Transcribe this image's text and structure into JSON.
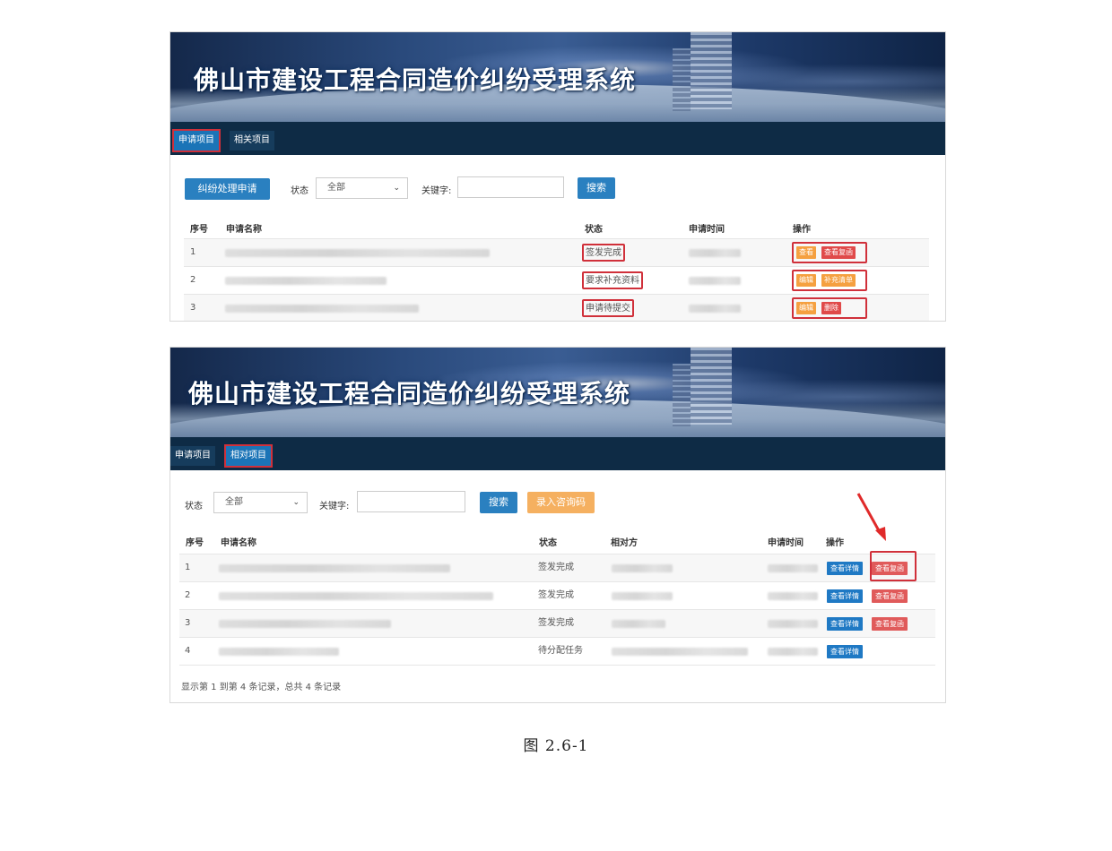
{
  "app_title": "佛山市建设工程合同造价纠纷受理系统",
  "screen1": {
    "tabs": [
      {
        "label": "申请项目"
      },
      {
        "label": "相关项目"
      }
    ],
    "apply_button": "纠纷处理申请",
    "status_label": "状态",
    "status_value": "全部",
    "keyword_label": "关键字:",
    "keyword_value": "",
    "search_button": "搜索",
    "columns": {
      "index": "序号",
      "name": "申请名称",
      "status": "状态",
      "time": "申请时间",
      "ops": "操作"
    },
    "rows": [
      {
        "index": "1",
        "status": "签发完成",
        "actions": [
          "查看",
          "查看复函"
        ]
      },
      {
        "index": "2",
        "status": "要求补充资料",
        "actions": [
          "编辑",
          "补充清单"
        ]
      },
      {
        "index": "3",
        "status": "申请待提交",
        "actions": [
          "编辑",
          "删除"
        ]
      }
    ]
  },
  "screen2": {
    "tabs": [
      {
        "label": "申请项目"
      },
      {
        "label": "相对项目"
      }
    ],
    "status_label": "状态",
    "status_value": "全部",
    "keyword_label": "关键字:",
    "keyword_value": "",
    "search_button": "搜索",
    "entry_button": "录入咨询码",
    "columns": {
      "index": "序号",
      "name": "申请名称",
      "status": "状态",
      "counterparty": "相对方",
      "time": "申请时间",
      "ops": "操作"
    },
    "rows": [
      {
        "index": "1",
        "status": "签发完成",
        "actions": [
          "查看详情",
          "查看复函"
        ]
      },
      {
        "index": "2",
        "status": "签发完成",
        "actions": [
          "查看详情",
          "查看复函"
        ]
      },
      {
        "index": "3",
        "status": "签发完成",
        "actions": [
          "查看详情",
          "查看复函"
        ]
      },
      {
        "index": "4",
        "status": "待分配任务",
        "actions": [
          "查看详情"
        ]
      }
    ],
    "footer": "显示第 1 到第 4 条记录，总共 4 条记录"
  },
  "caption": "图 2.6-1",
  "colors": {
    "nav": "#0e2b45",
    "accent_blue": "#1b74b7",
    "highlight_red": "#d0303a",
    "orange": "#f5a040"
  }
}
